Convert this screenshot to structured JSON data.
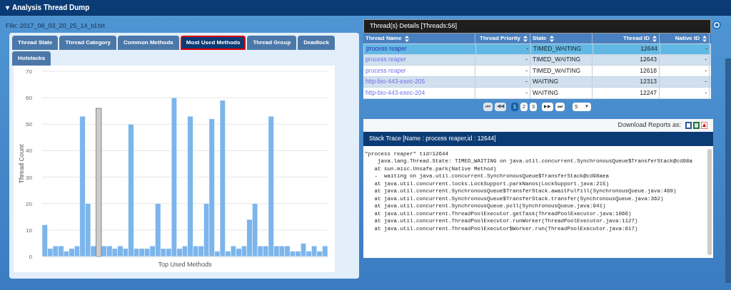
{
  "header": {
    "title": "Analysis Thread Dump",
    "caret": "▾"
  },
  "file_label": "File: 2017_08_03_20_25_14_td.txt",
  "tabs": [
    {
      "label": "Thread State",
      "selected": false
    },
    {
      "label": "Thread Category",
      "selected": false
    },
    {
      "label": "Common Methods",
      "selected": false
    },
    {
      "label": "Most Used Methods",
      "selected": true
    },
    {
      "label": "Thread Group",
      "selected": false
    },
    {
      "label": "Deadlock",
      "selected": false
    },
    {
      "label": "Hotstacks",
      "selected": false
    }
  ],
  "chart": {
    "chart_data": {
      "type": "bar",
      "xlabel": "Top Used Methods",
      "ylabel": "Thread Count",
      "ylim": [
        0,
        70
      ],
      "yticks": [
        0,
        10,
        20,
        30,
        40,
        50,
        60,
        70
      ],
      "grid": true,
      "series": [
        {
          "color": "#7cb5ec",
          "values": [
            12,
            3,
            4,
            4,
            2,
            3,
            4,
            53,
            20,
            4,
            null,
            4,
            4,
            3,
            4,
            3,
            50,
            3,
            3,
            3,
            4,
            20,
            3,
            3,
            60,
            3,
            4,
            53,
            4,
            4,
            20,
            52,
            2,
            59,
            2,
            4,
            3,
            4,
            14,
            20,
            4,
            4,
            53,
            4,
            4,
            4,
            2,
            2,
            5,
            2,
            4,
            2,
            4
          ]
        },
        {
          "color": "#cccccc",
          "values": [
            null,
            null,
            null,
            null,
            null,
            null,
            null,
            null,
            null,
            null,
            56,
            null,
            null,
            null,
            null,
            null,
            null,
            null,
            null,
            null,
            null,
            null,
            null,
            null,
            null,
            null,
            null,
            null,
            null,
            null,
            null,
            null,
            null,
            null,
            null,
            null,
            null,
            null,
            null,
            null,
            null,
            null,
            null,
            null,
            null,
            null,
            null,
            null,
            null,
            null,
            null,
            null,
            null
          ]
        }
      ]
    }
  },
  "details": {
    "title": "Thread(s) Details [Threads:56]",
    "columns": [
      {
        "label": "Thread Name"
      },
      {
        "label": "Thread Priority"
      },
      {
        "label": "State"
      },
      {
        "label": "Thread ID"
      },
      {
        "label": "Native ID"
      }
    ],
    "rows": [
      {
        "selected": true,
        "cells": [
          "process reaper",
          "-",
          "TIMED_WAITING",
          "12644",
          "-"
        ]
      },
      {
        "selected": false,
        "cells": [
          "process reaper",
          "-",
          "TIMED_WAITING",
          "12643",
          "-"
        ]
      },
      {
        "selected": false,
        "cells": [
          "process reaper",
          "-",
          "TIMED_WAITING",
          "12618",
          "-"
        ]
      },
      {
        "selected": false,
        "cells": [
          "http-bio-443-exec-205",
          "-",
          "WAITING",
          "12313",
          "-"
        ]
      },
      {
        "selected": false,
        "cells": [
          "http-bio-443-exec-204",
          "-",
          "WAITING",
          "12247",
          "-"
        ]
      }
    ],
    "pager": {
      "first": "⏮",
      "prev": "◀◀",
      "pages": [
        {
          "label": "1",
          "selected": true
        },
        {
          "label": "2",
          "selected": false
        },
        {
          "label": "3",
          "selected": false
        }
      ],
      "next": "▶▶",
      "last": "⏭",
      "page_size": "5",
      "page_size_caret": "▼"
    }
  },
  "downloads": {
    "label": "Download Reports as:"
  },
  "stack_trace": {
    "title": "Stack Trace [Name : process reaper,id : 12644]",
    "lines": [
      "\"process reaper\" tid=12644",
      "    java.lang.Thread.State: TIMED_WAITING on java.util.concurrent.SynchronousQueue$TransferStack@cd98a",
      "   at sun.misc.Unsafe.park(Native Method)",
      "   -  waiting on java.util.concurrent.SynchronousQueue$TransferStack@cd98aea",
      "   at java.util.concurrent.locks.LockSupport.parkNanos(LockSupport.java:215)",
      "   at java.util.concurrent.SynchronousQueue$TransferStack.awaitFulfill(SynchronousQueue.java:460)",
      "   at java.util.concurrent.SynchronousQueue$TransferStack.transfer(SynchronousQueue.java:362)",
      "   at java.util.concurrent.SynchronousQueue.poll(SynchronousQueue.java:941)",
      "   at java.util.concurrent.ThreadPoolExecutor.getTask(ThreadPoolExecutor.java:1066)",
      "   at java.util.concurrent.ThreadPoolExecutor.runWorker(ThreadPoolExecutor.java:1127)",
      "   at java.util.concurrent.ThreadPoolExecutor$Worker.run(ThreadPoolExecutor.java:617)"
    ]
  }
}
